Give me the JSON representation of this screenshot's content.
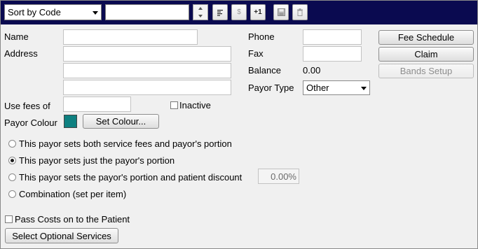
{
  "toolbar": {
    "sort_select": "Sort by Code",
    "search_value": "",
    "align_icon": "align-left-icon",
    "dollar_label": "$",
    "plus_one_label": "+1",
    "save_icon": "save-icon",
    "delete_icon": "trash-icon"
  },
  "form": {
    "name_label": "Name",
    "name_value": "",
    "address_label": "Address",
    "address_line1": "",
    "address_line2": "",
    "address_line3": "",
    "phone_label": "Phone",
    "phone_value": "",
    "fax_label": "Fax",
    "fax_value": "",
    "balance_label": "Balance",
    "balance_value": "0.00",
    "payor_type_label": "Payor Type",
    "payor_type_value": "Other",
    "use_fees_label": "Use fees of",
    "use_fees_value": "",
    "inactive_label": "Inactive",
    "inactive_checked": false,
    "payor_colour_label": "Payor Colour",
    "payor_colour": "#0e8080",
    "set_colour_label": "Set Colour..."
  },
  "buttons": {
    "fee_schedule": "Fee Schedule",
    "claim": "Claim",
    "bands_setup": "Bands Setup"
  },
  "options": [
    {
      "label": "This payor sets both service fees and payor's portion",
      "selected": false
    },
    {
      "label": "This payor sets just the payor's portion",
      "selected": true
    },
    {
      "label": "This payor sets the payor's portion and patient discount",
      "selected": false
    },
    {
      "label": "Combination (set per item)",
      "selected": false
    }
  ],
  "discount_value": "0.00%",
  "pass_costs_label": "Pass Costs on to the Patient",
  "pass_costs_checked": false,
  "select_optional_label": "Select Optional Services"
}
